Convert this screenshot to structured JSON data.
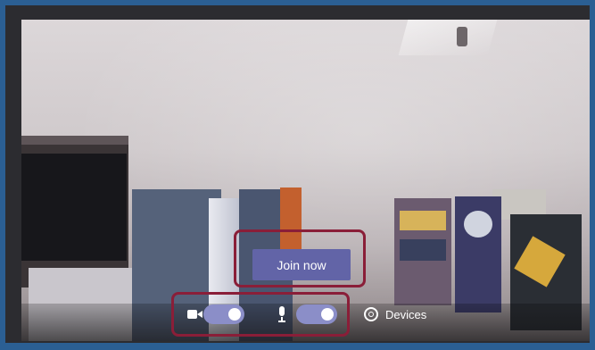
{
  "preview": {
    "join_label": "Join now"
  },
  "controls": {
    "camera_on": true,
    "mic_on": true,
    "devices_label": "Devices",
    "icons": [
      "camera-icon",
      "mic-icon",
      "gear-icon"
    ]
  },
  "colors": {
    "frame": "#2b5f93",
    "join_button": "#6264a7",
    "toggle_on": "#8b8ec8",
    "highlight": "#8a1e38"
  }
}
